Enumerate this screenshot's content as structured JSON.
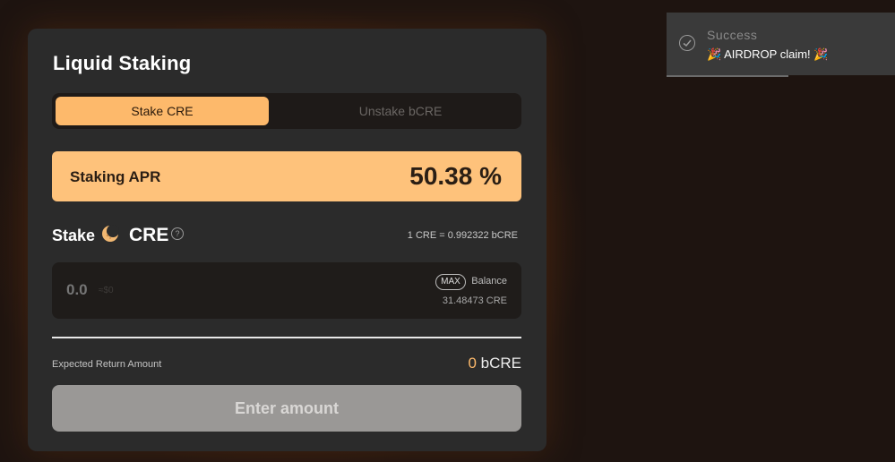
{
  "title": "Liquid Staking",
  "tabs": {
    "stake": "Stake CRE",
    "unstake": "Unstake bCRE"
  },
  "apr": {
    "label": "Staking APR",
    "value": "50.38 %"
  },
  "stake": {
    "label": "Stake",
    "token": "CRE",
    "icon": "moon-token-icon",
    "rate": "1 CRE = 0.992322 bCRE"
  },
  "input": {
    "placeholder": "0.0",
    "usd": "≈$0",
    "max_label": "MAX",
    "balance_label": "Balance",
    "balance_value": "31.48473 CRE"
  },
  "return": {
    "label": "Expected Return Amount",
    "amount": "0",
    "unit": "bCRE"
  },
  "button": {
    "label": "Enter amount"
  },
  "toast": {
    "title": "Success",
    "message": "AIRDROP claim!"
  },
  "colors": {
    "accent": "#fdb96b",
    "apr_bg": "#fec27b",
    "card_bg": "#2b2b2b",
    "page_bg": "#1e1410"
  }
}
